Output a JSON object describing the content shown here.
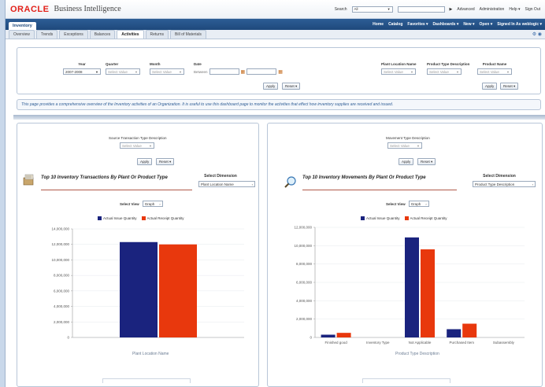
{
  "header": {
    "logo": "ORACLE",
    "product": "Business Intelligence",
    "search_label": "Search",
    "search_scope": "All",
    "links": [
      "Advanced",
      "Administration",
      "Help ▾",
      "Sign Out"
    ]
  },
  "dashboard": {
    "title": "Inventory",
    "menu": [
      "Home",
      "Catalog",
      "Favorites ▾",
      "Dashboards ▾",
      "New ▾",
      "Open ▾",
      "Signed In As  weblogic ▾"
    ]
  },
  "tabs": [
    "Overview",
    "Trends",
    "Exceptions",
    "Balances",
    "Activities",
    "Returns",
    "Bill of Materials"
  ],
  "active_tab": "Activities",
  "prompts": {
    "year": {
      "label": "Year",
      "value": "2007-2008"
    },
    "quarter": {
      "label": "Quarter",
      "value": "Select Value"
    },
    "month": {
      "label": "Month",
      "value": "Select Value"
    },
    "date": {
      "label": "Date",
      "value": "Between"
    },
    "plant": {
      "label": "Plant Location Name",
      "value": "Select Value"
    },
    "ptype": {
      "label": "Product Type Description",
      "value": "Select Value"
    },
    "pname": {
      "label": "Product Name",
      "value": "Select Value"
    },
    "apply": "Apply",
    "reset": "Reset ▾"
  },
  "description": "This page provides a comprehensive overview of the Inventory activities of an Organization. It is useful to use this dashboard page to monitor the activities that effect how inventory supplies are received and issued.",
  "left_panel": {
    "prompt_label": "Source Transaction Type Description",
    "prompt_value": "Select Value",
    "apply": "Apply",
    "reset": "Reset ▾",
    "title": "Top 10 Inventory Transactions By Plant Or Product Type",
    "dim_label": "Select Dimension",
    "dim_value": "Plant Location Name",
    "view_label": "Select View",
    "view_value": "Graph"
  },
  "right_panel": {
    "prompt_label": "Movement Type Description",
    "prompt_value": "Select Value",
    "apply": "Apply",
    "reset": "Reset ▾",
    "title": "Top 10 Inventory Movements By Plant Or Product Type",
    "dim_label": "Select Dimension",
    "dim_value": "Product Type Description",
    "view_label": "Select View",
    "view_value": "Graph"
  },
  "colors": {
    "issue": "#1a237e",
    "receipt": "#e8380d"
  },
  "chart_data": [
    {
      "type": "bar",
      "xlabel": "Plant Location Name",
      "ylim": [
        0,
        14000000
      ],
      "yticks": [
        "0",
        "2,000,000",
        "4,000,000",
        "6,000,000",
        "8,000,000",
        "10,000,000",
        "12,000,000",
        "14,000,000"
      ],
      "categories": [
        ""
      ],
      "series": [
        {
          "name": "Actual Issue Quantity",
          "values": [
            12300000
          ]
        },
        {
          "name": "Actual Receipt Quantity",
          "values": [
            12000000
          ]
        }
      ]
    },
    {
      "type": "bar",
      "xlabel": "Product Type Description",
      "ylim": [
        0,
        12000000
      ],
      "yticks": [
        "0",
        "2,000,000",
        "4,000,000",
        "6,000,000",
        "8,000,000",
        "10,000,000",
        "12,000,000"
      ],
      "categories": [
        "Finished good",
        "Inventory Type",
        "Not Applicable",
        "Purchased Item",
        "Subassembly"
      ],
      "series": [
        {
          "name": "Actual Issue Quantity",
          "values": [
            300000,
            0,
            10900000,
            900000,
            0
          ]
        },
        {
          "name": "Actual Receipt Quantity",
          "values": [
            500000,
            0,
            9600000,
            1500000,
            0
          ]
        }
      ]
    }
  ]
}
